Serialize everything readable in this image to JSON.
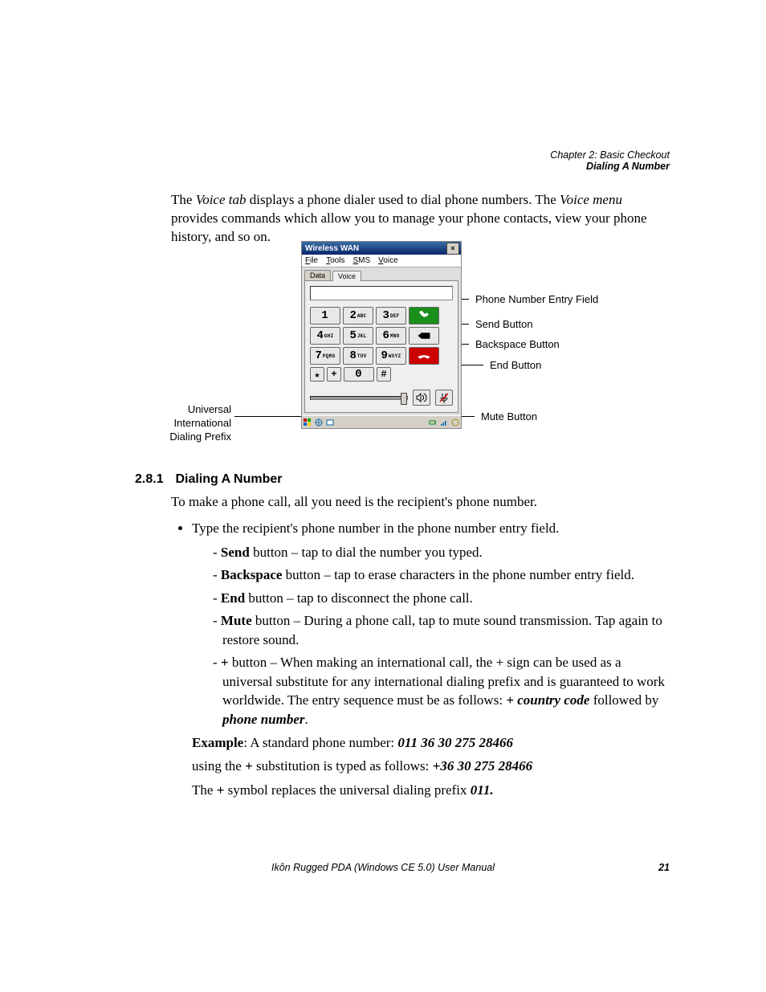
{
  "header": {
    "chapter": "Chapter 2: Basic Checkout",
    "section": "Dialing A Number"
  },
  "intro": {
    "p1a": "The ",
    "p1b": "Voice tab",
    "p1c": " displays a phone dialer used to dial phone numbers. The ",
    "p1d": "Voice menu",
    "p1e": " provides commands which allow you to manage your phone contacts, view your phone history, and so on."
  },
  "callouts": {
    "entry": "Phone Number Entry Field",
    "send": "Send Button",
    "backspace": "Backspace Button",
    "end": "End Button",
    "mute": "Mute Button",
    "prefix1": "Universal",
    "prefix2": "International",
    "prefix3": "Dialing Prefix"
  },
  "window": {
    "title": "Wireless WAN",
    "menus": {
      "file": "File",
      "tools": "Tools",
      "sms": "SMS",
      "voice": "Voice"
    },
    "tabs": {
      "data": "Data",
      "voice": "Voice"
    },
    "keys": {
      "1": "1",
      "2": "2",
      "2s": "ABC",
      "3": "3",
      "3s": "DEF",
      "4": "4",
      "4s": "GHI",
      "5": "5",
      "5s": "JKL",
      "6": "6",
      "6s": "MNO",
      "7": "7",
      "7s": "PQRS",
      "8": "8",
      "8s": "TUV",
      "9": "9",
      "9s": "WXYZ",
      "star": "★",
      "plus": "+",
      "0": "0",
      "hash": "#"
    }
  },
  "section": {
    "num": "2.8.1",
    "title": "Dialing A Number",
    "lead": "To make a phone call, all you need is the recipient's phone number.",
    "bullet1": "Type the recipient's phone number in the phone number entry field.",
    "send_b": "Send",
    "send_t": " button – tap to dial the number you typed.",
    "bksp_b": "Backspace",
    "bksp_t": " button – tap to erase characters in the phone number entry field.",
    "end_b": "End",
    "end_t": " button – tap to disconnect the phone call.",
    "mute_b": "Mute",
    "mute_t": " button – During a phone call, tap to mute sound transmission. Tap again to restore sound.",
    "plus_b": "+",
    "plus_t1": " button – When making an international call, the + sign can be used as a universal substitute for any international dialing prefix and is guaranteed to work worldwide. The entry sequence must be as follows: ",
    "plus_e1": "+ country code",
    "plus_t2": " followed by ",
    "plus_e2": "phone number",
    "plus_t3": ".",
    "ex_b": "Example",
    "ex_t1": ": A standard phone number: ",
    "ex_i1": "011 36 30 275 28466",
    "ex2_t1": "using the ",
    "ex2_b": "+",
    "ex2_t2": " substitution is typed as follows: ",
    "ex2_i": "+36 30 275 28466",
    "ex3_t1": "The ",
    "ex3_b": "+",
    "ex3_t2": " symbol replaces the universal dialing prefix ",
    "ex3_i": "011."
  },
  "footer": {
    "manual": "Ikôn Rugged PDA (Windows CE 5.0) User Manual",
    "page": "21"
  }
}
